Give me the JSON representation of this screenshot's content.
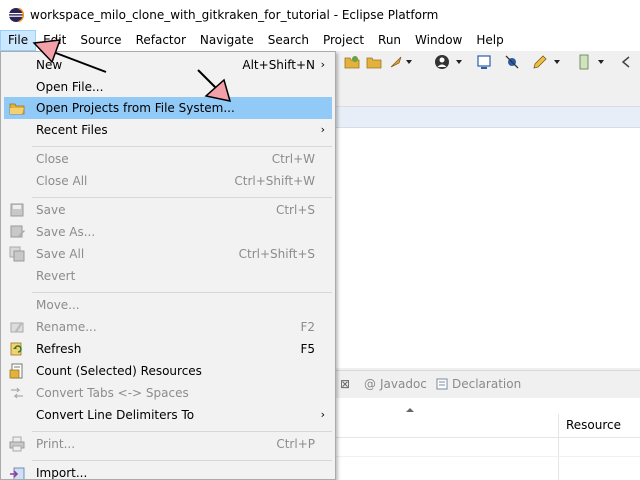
{
  "window": {
    "title": "workspace_milo_clone_with_gitkraken_for_tutorial - Eclipse Platform",
    "icon": "eclipse-icon"
  },
  "menubar": {
    "items": [
      "File",
      "Edit",
      "Source",
      "Refactor",
      "Navigate",
      "Search",
      "Project",
      "Run",
      "Window",
      "Help"
    ],
    "active": "File"
  },
  "file_menu": {
    "items": [
      {
        "label": "New",
        "accel": "Alt+Shift+N",
        "submenu": true,
        "enabled": true,
        "icon": ""
      },
      {
        "label": "Open File...",
        "accel": "",
        "submenu": false,
        "enabled": true,
        "icon": ""
      },
      {
        "label": "Open Projects from File System...",
        "accel": "",
        "submenu": false,
        "enabled": true,
        "icon": "folder-icon",
        "highlighted": true
      },
      {
        "label": "Recent Files",
        "accel": "",
        "submenu": true,
        "enabled": true,
        "icon": ""
      },
      {
        "label": "Close",
        "accel": "Ctrl+W",
        "submenu": false,
        "enabled": false,
        "icon": ""
      },
      {
        "label": "Close All",
        "accel": "Ctrl+Shift+W",
        "submenu": false,
        "enabled": false,
        "icon": ""
      },
      {
        "label": "Save",
        "accel": "Ctrl+S",
        "submenu": false,
        "enabled": false,
        "icon": "save-icon"
      },
      {
        "label": "Save As...",
        "accel": "",
        "submenu": false,
        "enabled": false,
        "icon": "save-as-icon"
      },
      {
        "label": "Save All",
        "accel": "Ctrl+Shift+S",
        "submenu": false,
        "enabled": false,
        "icon": "save-all-icon"
      },
      {
        "label": "Revert",
        "accel": "",
        "submenu": false,
        "enabled": false,
        "icon": ""
      },
      {
        "label": "Move...",
        "accel": "",
        "submenu": false,
        "enabled": false,
        "icon": ""
      },
      {
        "label": "Rename...",
        "accel": "F2",
        "submenu": false,
        "enabled": false,
        "icon": "rename-icon"
      },
      {
        "label": "Refresh",
        "accel": "F5",
        "submenu": false,
        "enabled": true,
        "icon": "refresh-icon"
      },
      {
        "label": "Count (Selected) Resources",
        "accel": "",
        "submenu": false,
        "enabled": true,
        "icon": "count-icon"
      },
      {
        "label": "Convert Tabs <-> Spaces",
        "accel": "",
        "submenu": false,
        "enabled": false,
        "icon": "convert-tabs-icon"
      },
      {
        "label": "Convert Line Delimiters To",
        "accel": "",
        "submenu": true,
        "enabled": true,
        "icon": ""
      },
      {
        "label": "Print...",
        "accel": "Ctrl+P",
        "submenu": false,
        "enabled": false,
        "icon": "print-icon"
      },
      {
        "label": "Import...",
        "accel": "",
        "submenu": false,
        "enabled": true,
        "icon": "import-icon"
      }
    ]
  },
  "bottom_panel": {
    "tabs": [
      {
        "label": "Javadoc",
        "icon": "javadoc-icon"
      },
      {
        "label": "Declaration",
        "icon": "declaration-icon"
      }
    ],
    "columns": [
      "Resource"
    ]
  },
  "colors": {
    "highlight": "#91c9f7",
    "menu_bg": "#f2f2f2",
    "disabled_text": "#8c8c8c",
    "annotation_arrow": "#f4a0a8"
  }
}
